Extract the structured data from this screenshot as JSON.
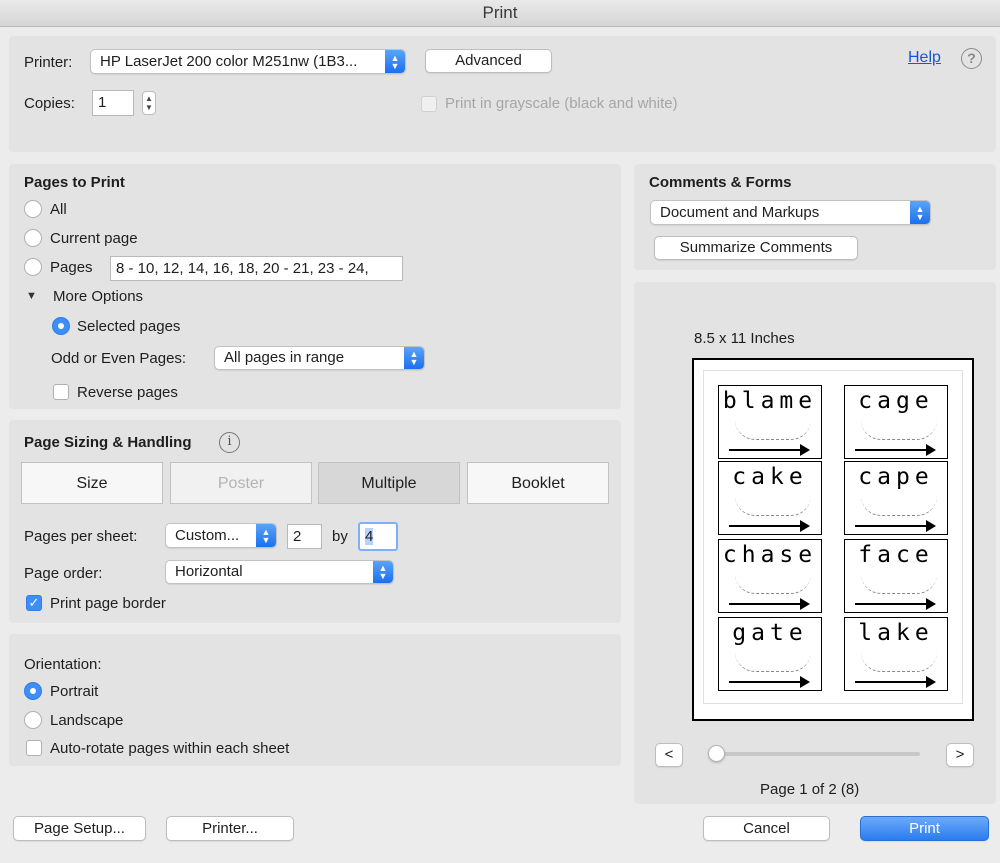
{
  "window": {
    "title": "Print"
  },
  "printer": {
    "label": "Printer:",
    "value": "HP LaserJet 200 color M251nw (1B3...",
    "advanced_label": "Advanced",
    "help_label": "Help",
    "copies_label": "Copies:",
    "copies_value": "1",
    "grayscale_label": "Print in grayscale (black and white)"
  },
  "pages_to_print": {
    "heading": "Pages to Print",
    "all_label": "All",
    "current_label": "Current page",
    "pages_label": "Pages",
    "pages_value": "8 - 10, 12, 14, 16, 18, 20 - 21, 23 - 24,",
    "more_options_label": "More Options",
    "selected_pages_label": "Selected pages",
    "odd_even_label": "Odd or Even Pages:",
    "odd_even_value": "All pages in range",
    "reverse_label": "Reverse pages",
    "selected": "Pages"
  },
  "sizing": {
    "heading": "Page Sizing & Handling",
    "tabs": [
      "Size",
      "Poster",
      "Multiple",
      "Booklet"
    ],
    "selected_tab": "Multiple",
    "pages_per_sheet_label": "Pages per sheet:",
    "pages_per_sheet_value": "Custom...",
    "cols_value": "2",
    "by_label": "by",
    "rows_value": "4",
    "page_order_label": "Page order:",
    "page_order_value": "Horizontal",
    "border_label": "Print page border",
    "border_checked": true
  },
  "orientation": {
    "heading": "Orientation:",
    "portrait_label": "Portrait",
    "landscape_label": "Landscape",
    "autorotate_label": "Auto-rotate pages within each sheet",
    "selected": "Portrait"
  },
  "comments": {
    "heading": "Comments & Forms",
    "value": "Document and Markups",
    "summarize_label": "Summarize Comments"
  },
  "preview": {
    "paper_size": "8.5 x 11 Inches",
    "words": [
      "blame",
      "cage",
      "cake",
      "cape",
      "chase",
      "face",
      "gate",
      "lake"
    ],
    "prev_label": "<",
    "next_label": ">",
    "page_status": "Page 1 of 2 (8)",
    "slider_fraction": 0
  },
  "footer": {
    "page_setup_label": "Page Setup...",
    "printer_label": "Printer...",
    "cancel_label": "Cancel",
    "print_label": "Print"
  },
  "colors": {
    "accent": "#3d8ef7",
    "print_button": "#3b8df2"
  }
}
